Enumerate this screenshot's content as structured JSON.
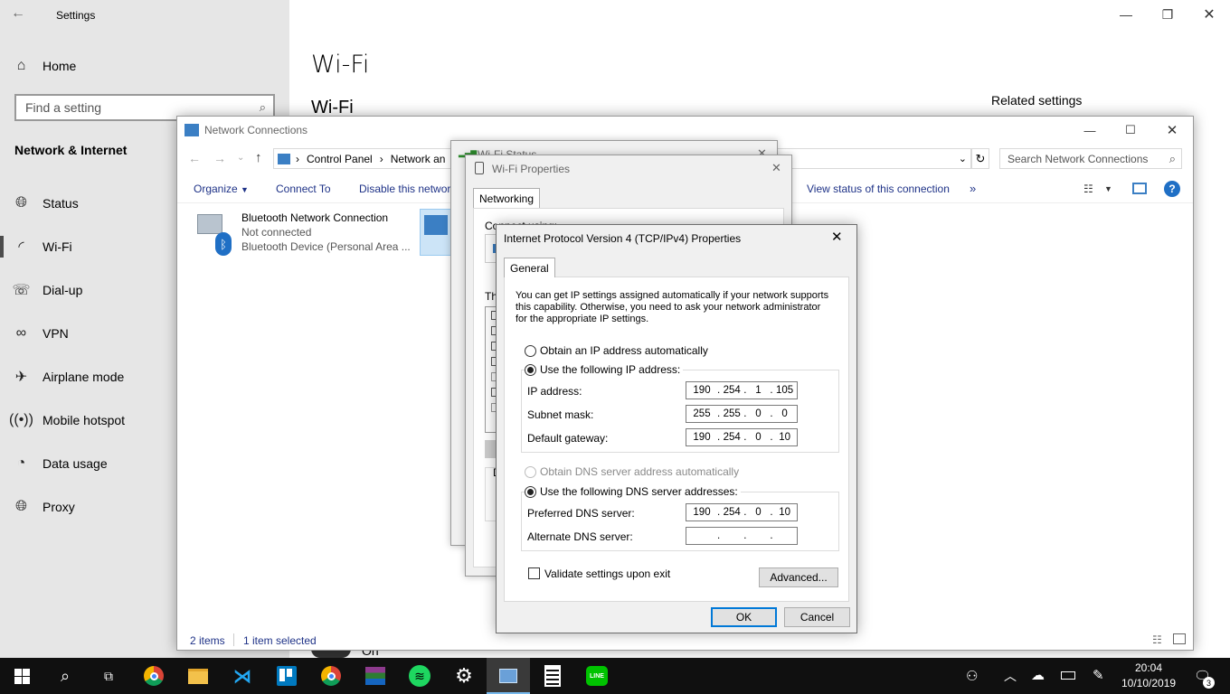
{
  "settings": {
    "title": "Settings",
    "home": "Home",
    "search_placeholder": "Find a setting",
    "category": "Network & Internet",
    "nav": [
      {
        "label": "Status",
        "icon": "globe-icon"
      },
      {
        "label": "Wi-Fi",
        "icon": "wifi-icon"
      },
      {
        "label": "Dial-up",
        "icon": "dialup-icon"
      },
      {
        "label": "VPN",
        "icon": "vpn-icon"
      },
      {
        "label": "Airplane mode",
        "icon": "airplane-icon"
      },
      {
        "label": "Mobile hotspot",
        "icon": "hotspot-icon"
      },
      {
        "label": "Data usage",
        "icon": "data-usage-icon"
      },
      {
        "label": "Proxy",
        "icon": "globe-icon"
      }
    ],
    "page_title": "Wi-Fi",
    "section_title": "Wi-Fi",
    "related_settings": "Related settings",
    "toggle_text": "On"
  },
  "netconn": {
    "title": "Network Connections",
    "address": {
      "segments": [
        "Control Panel",
        "Network an"
      ]
    },
    "search_placeholder": "Search Network Connections",
    "toolbar": {
      "organize": "Organize",
      "connect_to": "Connect To",
      "disable": "Disable this networ",
      "view_status": "View status of this connection",
      "more": "»"
    },
    "item": {
      "name": "Bluetooth Network Connection",
      "status": "Not connected",
      "device": "Bluetooth Device (Personal Area ..."
    },
    "statusbar": {
      "count": "2 items",
      "selected": "1 item selected"
    }
  },
  "wifi_status": {
    "title": "Wi-Fi Status"
  },
  "wifi_props": {
    "title": "Wi-Fi Properties",
    "tab": "Networking",
    "connect_using": "Connect using:",
    "this_uses": "Th",
    "d_label": "D"
  },
  "ipv4": {
    "title": "Internet Protocol Version 4 (TCP/IPv4) Properties",
    "tab": "General",
    "intro": "You can get IP settings assigned automatically if your network supports this capability. Otherwise, you need to ask your network administrator for the appropriate IP settings.",
    "intro_lines": [
      "You can get IP settings assigned automatically if your network supports",
      "this capability. Otherwise, you need to ask your network administrator",
      "for the appropriate IP settings."
    ],
    "obtain_ip": "Obtain an IP address automatically",
    "use_ip": "Use the following IP address:",
    "ip_label": "IP address:",
    "ip": [
      "190",
      "254",
      "1",
      "105"
    ],
    "mask_label": "Subnet mask:",
    "mask": [
      "255",
      "255",
      "0",
      "0"
    ],
    "gateway_label": "Default gateway:",
    "gateway": [
      "190",
      "254",
      "0",
      "10"
    ],
    "obtain_dns": "Obtain DNS server address automatically",
    "use_dns": "Use the following DNS server addresses:",
    "pref_dns_label": "Preferred DNS server:",
    "pref_dns": [
      "190",
      "254",
      "0",
      "10"
    ],
    "alt_dns_label": "Alternate DNS server:",
    "alt_dns": [
      "",
      "",
      "",
      ""
    ],
    "validate": "Validate settings upon exit",
    "advanced": "Advanced...",
    "ok": "OK",
    "cancel": "Cancel"
  },
  "taskbar": {
    "time": "20:04",
    "date": "10/10/2019",
    "notifications": "3"
  }
}
